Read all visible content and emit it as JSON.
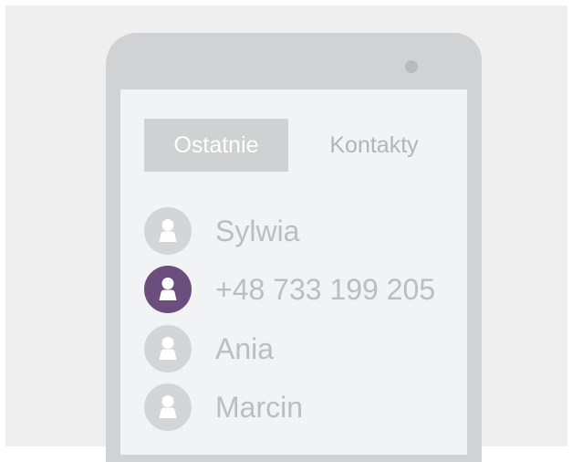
{
  "colors": {
    "background": "#efefef",
    "phone_body": "#d1d2d4",
    "screen": "#f2f3f5",
    "tab_active_bg": "#d0d1d3",
    "text_muted": "#bcbdbf",
    "accent_avatar": "#6b4e7d"
  },
  "tabs": [
    {
      "label": "Ostatnie",
      "active": true
    },
    {
      "label": "Kontakty",
      "active": false
    }
  ],
  "contacts": [
    {
      "label": "Sylwia",
      "icon": "person-icon",
      "highlighted": false
    },
    {
      "label": "+48 733 199 205",
      "icon": "person-icon",
      "highlighted": true
    },
    {
      "label": "Ania",
      "icon": "person-icon",
      "highlighted": false
    },
    {
      "label": "Marcin",
      "icon": "person-icon",
      "highlighted": false
    }
  ]
}
